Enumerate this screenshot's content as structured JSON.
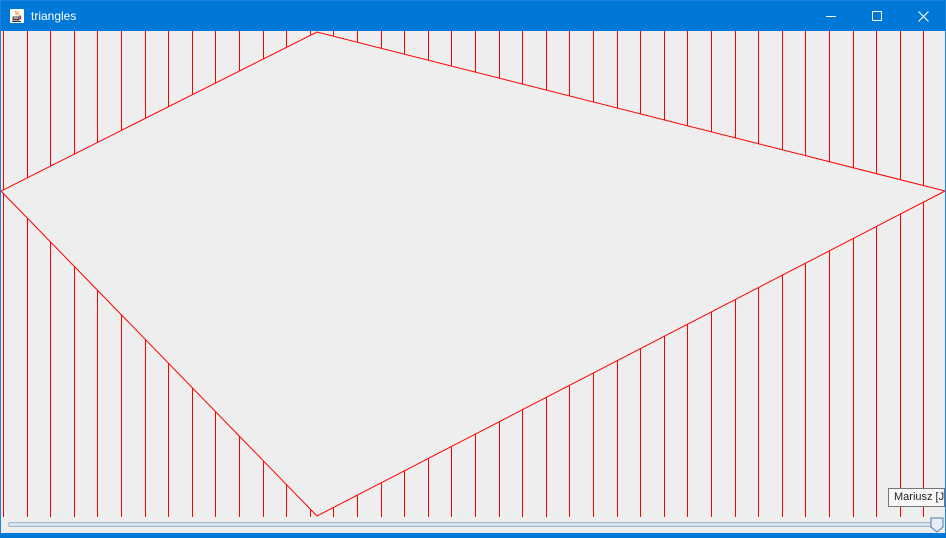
{
  "window": {
    "title": "triangles"
  },
  "tooltip": {
    "text": "Mariusz [J"
  },
  "slider": {
    "value_fraction": 1.0
  },
  "colors": {
    "titlebar": "#0078d7",
    "canvas": "#eeeeee",
    "lines": "#ff0000"
  },
  "icons": [
    "java-app-icon",
    "minimize-icon",
    "maximize-icon",
    "close-icon"
  ]
}
